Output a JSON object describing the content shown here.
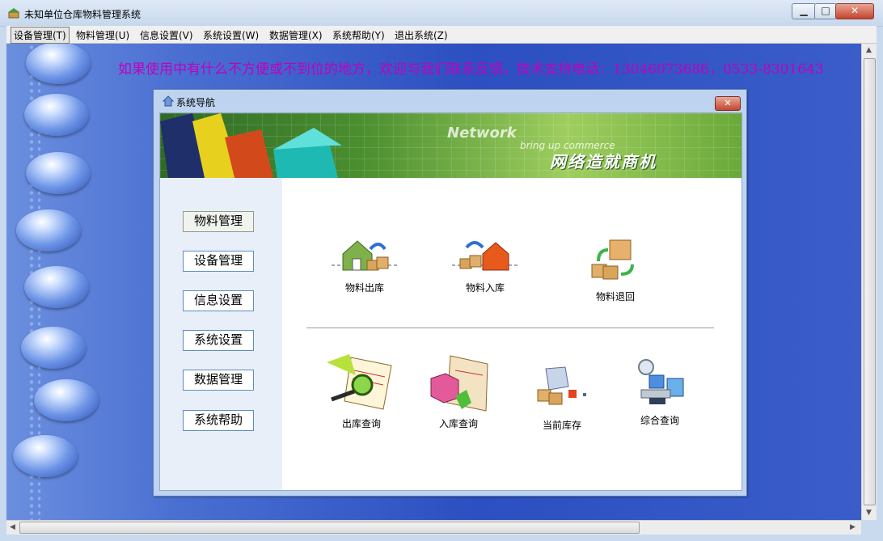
{
  "window": {
    "title": "未知单位仓库物料管理系统"
  },
  "menu": [
    {
      "label": "设备管理(T)",
      "active": true
    },
    {
      "label": "物料管理(U)",
      "active": false
    },
    {
      "label": "信息设置(V)",
      "active": false
    },
    {
      "label": "系统设置(W)",
      "active": false
    },
    {
      "label": "数据管理(X)",
      "active": false
    },
    {
      "label": "系统帮助(Y)",
      "active": false
    },
    {
      "label": "退出系统(Z)",
      "active": false
    }
  ],
  "marquee": "如果使用中有什么不方便或不到位的地方，欢迎与我们联系反馈。技术支持电话：13046073686，0533-8301643",
  "dialog": {
    "title": "系统导航",
    "banner": {
      "network": "Network",
      "bring": "bring up commerce",
      "slogan": "网络造就商机"
    },
    "nav_buttons": [
      "物料管理",
      "设备管理",
      "信息设置",
      "系统设置",
      "数据管理",
      "系统帮助"
    ],
    "tiles_top": [
      {
        "label": "物料出库",
        "icon": "warehouse-out-icon"
      },
      {
        "label": "物料入库",
        "icon": "warehouse-in-icon"
      },
      {
        "label": "物料退回",
        "icon": "boxes-return-icon"
      }
    ],
    "tiles_bottom": [
      {
        "label": "出库查询",
        "icon": "magnifier-document-icon"
      },
      {
        "label": "入库查询",
        "icon": "box-document-icon"
      },
      {
        "label": "当前库存",
        "icon": "stock-boxes-icon"
      },
      {
        "label": "综合查询",
        "icon": "computer-network-icon"
      }
    ]
  },
  "colors": {
    "marquee": "#c000c0",
    "desktop": "#2c4fc1"
  }
}
